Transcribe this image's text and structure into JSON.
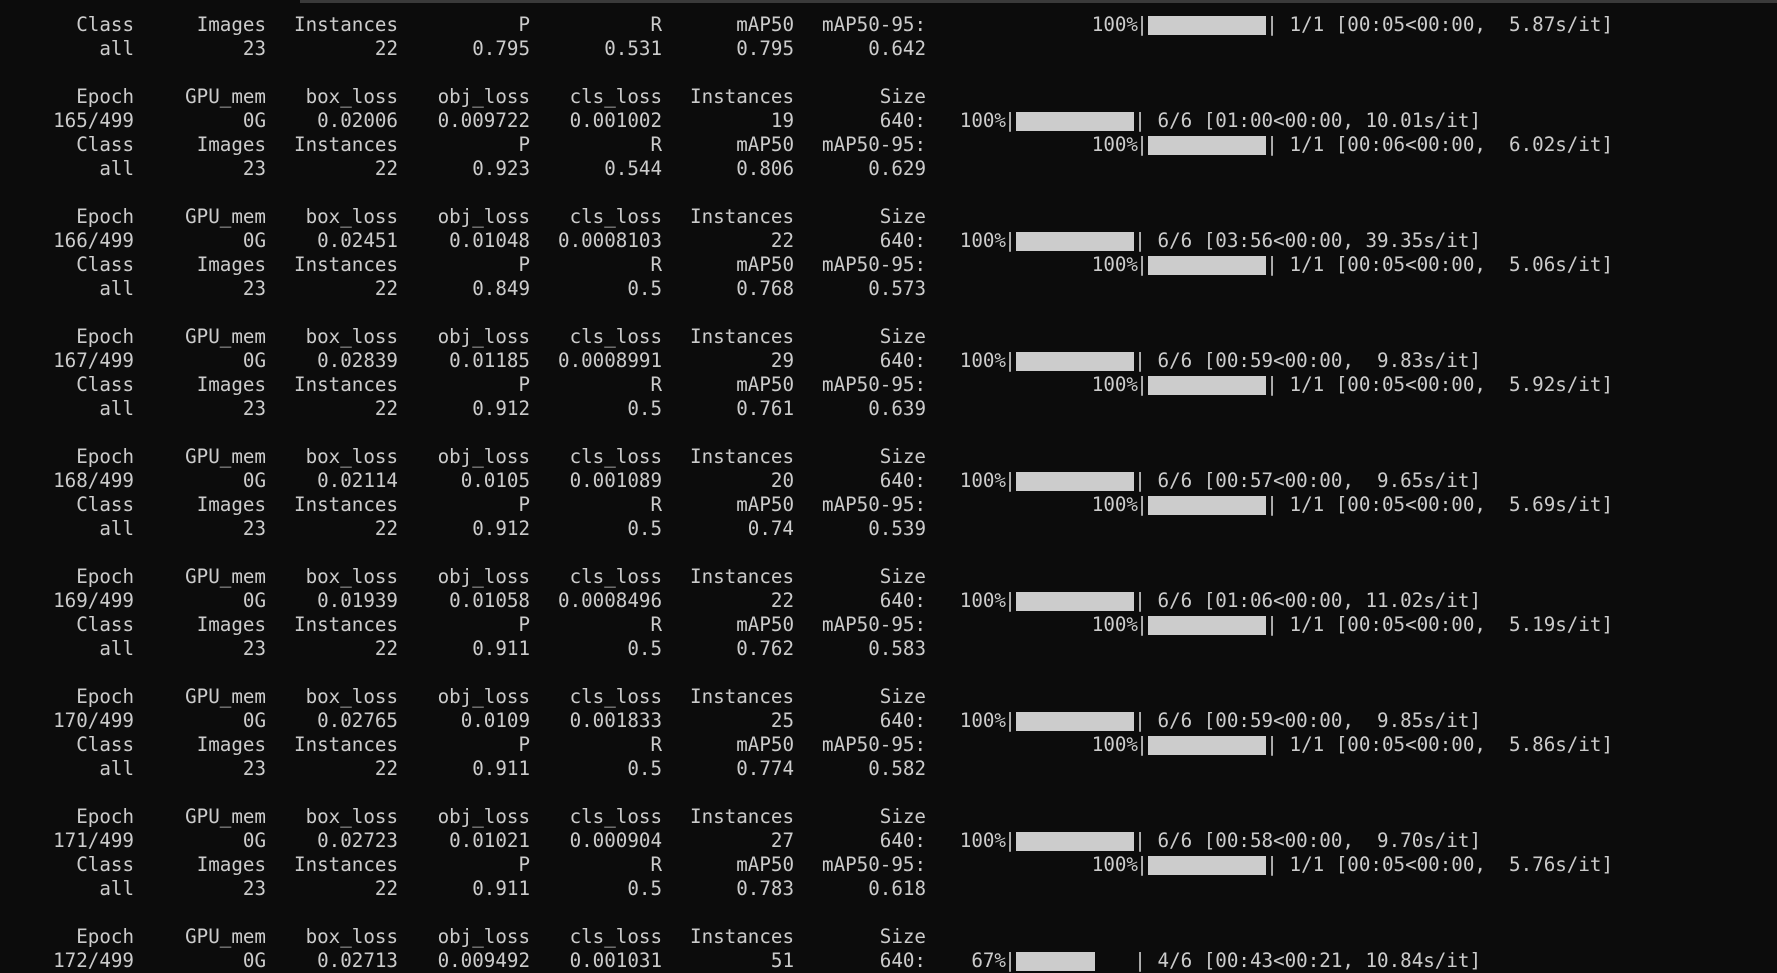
{
  "terminal": {
    "train_header": [
      "Epoch",
      "GPU_mem",
      "box_loss",
      "obj_loss",
      "cls_loss",
      "Instances",
      "Size"
    ],
    "val_header": [
      "Class",
      "Images",
      "Instances",
      "P",
      "R",
      "mAP50",
      "mAP50-95:"
    ],
    "top_val": {
      "header_percent": "100%",
      "header_progress": 1.0,
      "header_suffix": " 1/1 [00:05<00:00,  5.87s/it]",
      "row": [
        "all",
        "23",
        "22",
        "0.795",
        "0.531",
        "0.795",
        "0.642"
      ]
    },
    "epochs": [
      {
        "train": [
          "165/499",
          "0G",
          "0.02006",
          "0.009722",
          "0.001002",
          "19",
          "640:"
        ],
        "train_percent": "100%",
        "train_progress": 1.0,
        "train_suffix": " 6/6 [01:00<00:00, 10.01s/it]",
        "val_percent": "100%",
        "val_progress": 1.0,
        "val_suffix": " 1/1 [00:06<00:00,  6.02s/it]",
        "val": [
          "all",
          "23",
          "22",
          "0.923",
          "0.544",
          "0.806",
          "0.629"
        ]
      },
      {
        "train": [
          "166/499",
          "0G",
          "0.02451",
          "0.01048",
          "0.0008103",
          "22",
          "640:"
        ],
        "train_percent": "100%",
        "train_progress": 1.0,
        "train_suffix": " 6/6 [03:56<00:00, 39.35s/it]",
        "val_percent": "100%",
        "val_progress": 1.0,
        "val_suffix": " 1/1 [00:05<00:00,  5.06s/it]",
        "val": [
          "all",
          "23",
          "22",
          "0.849",
          "0.5",
          "0.768",
          "0.573"
        ]
      },
      {
        "train": [
          "167/499",
          "0G",
          "0.02839",
          "0.01185",
          "0.0008991",
          "29",
          "640:"
        ],
        "train_percent": "100%",
        "train_progress": 1.0,
        "train_suffix": " 6/6 [00:59<00:00,  9.83s/it]",
        "val_percent": "100%",
        "val_progress": 1.0,
        "val_suffix": " 1/1 [00:05<00:00,  5.92s/it]",
        "val": [
          "all",
          "23",
          "22",
          "0.912",
          "0.5",
          "0.761",
          "0.639"
        ]
      },
      {
        "train": [
          "168/499",
          "0G",
          "0.02114",
          "0.0105",
          "0.001089",
          "20",
          "640:"
        ],
        "train_percent": "100%",
        "train_progress": 1.0,
        "train_suffix": " 6/6 [00:57<00:00,  9.65s/it]",
        "val_percent": "100%",
        "val_progress": 1.0,
        "val_suffix": " 1/1 [00:05<00:00,  5.69s/it]",
        "val": [
          "all",
          "23",
          "22",
          "0.912",
          "0.5",
          "0.74",
          "0.539"
        ]
      },
      {
        "train": [
          "169/499",
          "0G",
          "0.01939",
          "0.01058",
          "0.0008496",
          "22",
          "640:"
        ],
        "train_percent": "100%",
        "train_progress": 1.0,
        "train_suffix": " 6/6 [01:06<00:00, 11.02s/it]",
        "val_percent": "100%",
        "val_progress": 1.0,
        "val_suffix": " 1/1 [00:05<00:00,  5.19s/it]",
        "val": [
          "all",
          "23",
          "22",
          "0.911",
          "0.5",
          "0.762",
          "0.583"
        ]
      },
      {
        "train": [
          "170/499",
          "0G",
          "0.02765",
          "0.0109",
          "0.001833",
          "25",
          "640:"
        ],
        "train_percent": "100%",
        "train_progress": 1.0,
        "train_suffix": " 6/6 [00:59<00:00,  9.85s/it]",
        "val_percent": "100%",
        "val_progress": 1.0,
        "val_suffix": " 1/1 [00:05<00:00,  5.86s/it]",
        "val": [
          "all",
          "23",
          "22",
          "0.911",
          "0.5",
          "0.774",
          "0.582"
        ]
      },
      {
        "train": [
          "171/499",
          "0G",
          "0.02723",
          "0.01021",
          "0.000904",
          "27",
          "640:"
        ],
        "train_percent": "100%",
        "train_progress": 1.0,
        "train_suffix": " 6/6 [00:58<00:00,  9.70s/it]",
        "val_percent": "100%",
        "val_progress": 1.0,
        "val_suffix": " 1/1 [00:05<00:00,  5.76s/it]",
        "val": [
          "all",
          "23",
          "22",
          "0.911",
          "0.5",
          "0.783",
          "0.618"
        ]
      }
    ],
    "current": {
      "train": [
        "172/499",
        "0G",
        "0.02713",
        "0.009492",
        "0.001031",
        "51",
        "640:"
      ],
      "train_percent": " 67%",
      "train_progress": 0.67,
      "train_suffix": " 4/6 [00:43<00:21, 10.84s/it]"
    }
  }
}
